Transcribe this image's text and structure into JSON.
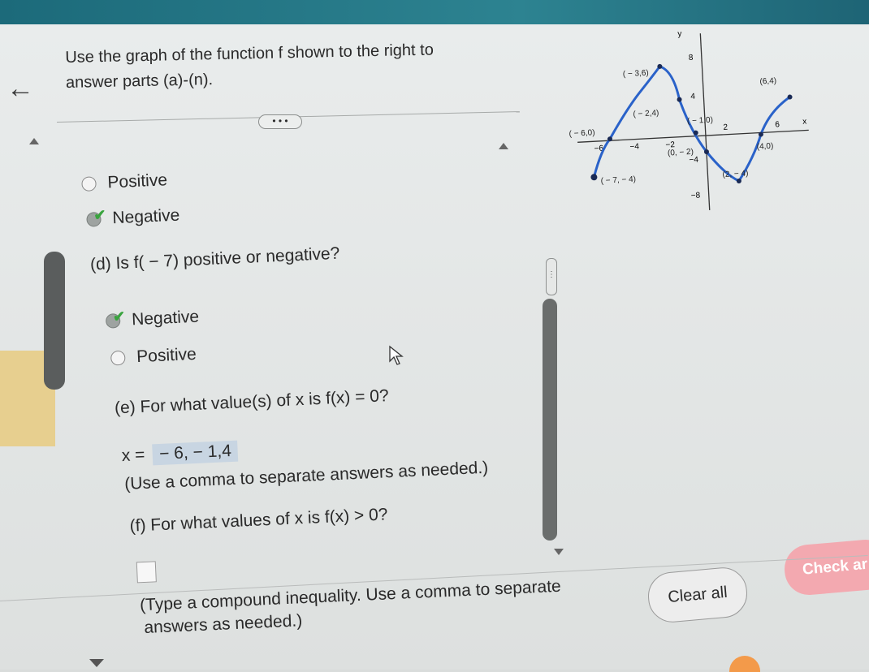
{
  "intro_text": "Use the graph of the function f shown to the right to answer parts (a)-(n).",
  "more_label": "• • •",
  "part_c": {
    "options": [
      {
        "label": "Positive",
        "selected": false
      },
      {
        "label": "Negative",
        "selected": true
      }
    ]
  },
  "part_d": {
    "question": "(d) Is f( − 7) positive or negative?",
    "options": [
      {
        "label": "Negative",
        "selected": true
      },
      {
        "label": "Positive",
        "selected": false
      }
    ]
  },
  "part_e": {
    "question": "(e) For what value(s) of x is f(x) = 0?",
    "answer_prefix": "x =",
    "answer_value": " − 6, − 1,4",
    "hint": "(Use a comma to separate answers as needed.)"
  },
  "part_f": {
    "question": "(f) For what values of x is f(x) > 0?",
    "hint_line1": "(Type a compound inequality. Use a comma to separate",
    "hint_line2": "answers as needed.)"
  },
  "buttons": {
    "clear_all": "Clear all",
    "check_answer": "Check ar"
  },
  "graph": {
    "y_axis_label": "y",
    "x_axis_label": "x",
    "points": [
      {
        "label": "( − 3,6)"
      },
      {
        "label": "(6,4)"
      },
      {
        "label": "( − 2,4)"
      },
      {
        "label": "( − 1,0)"
      },
      {
        "label": "( − 6,0)"
      },
      {
        "label": "(0, − 2)"
      },
      {
        "label": "(4,0)"
      },
      {
        "label": "( − 7, − 4)"
      },
      {
        "label": "(2, − 4)"
      }
    ],
    "y_ticks": [
      "8",
      "4",
      "−4",
      "−8"
    ],
    "x_ticks": [
      "−6",
      "−4",
      "−2",
      "2",
      "6"
    ]
  }
}
